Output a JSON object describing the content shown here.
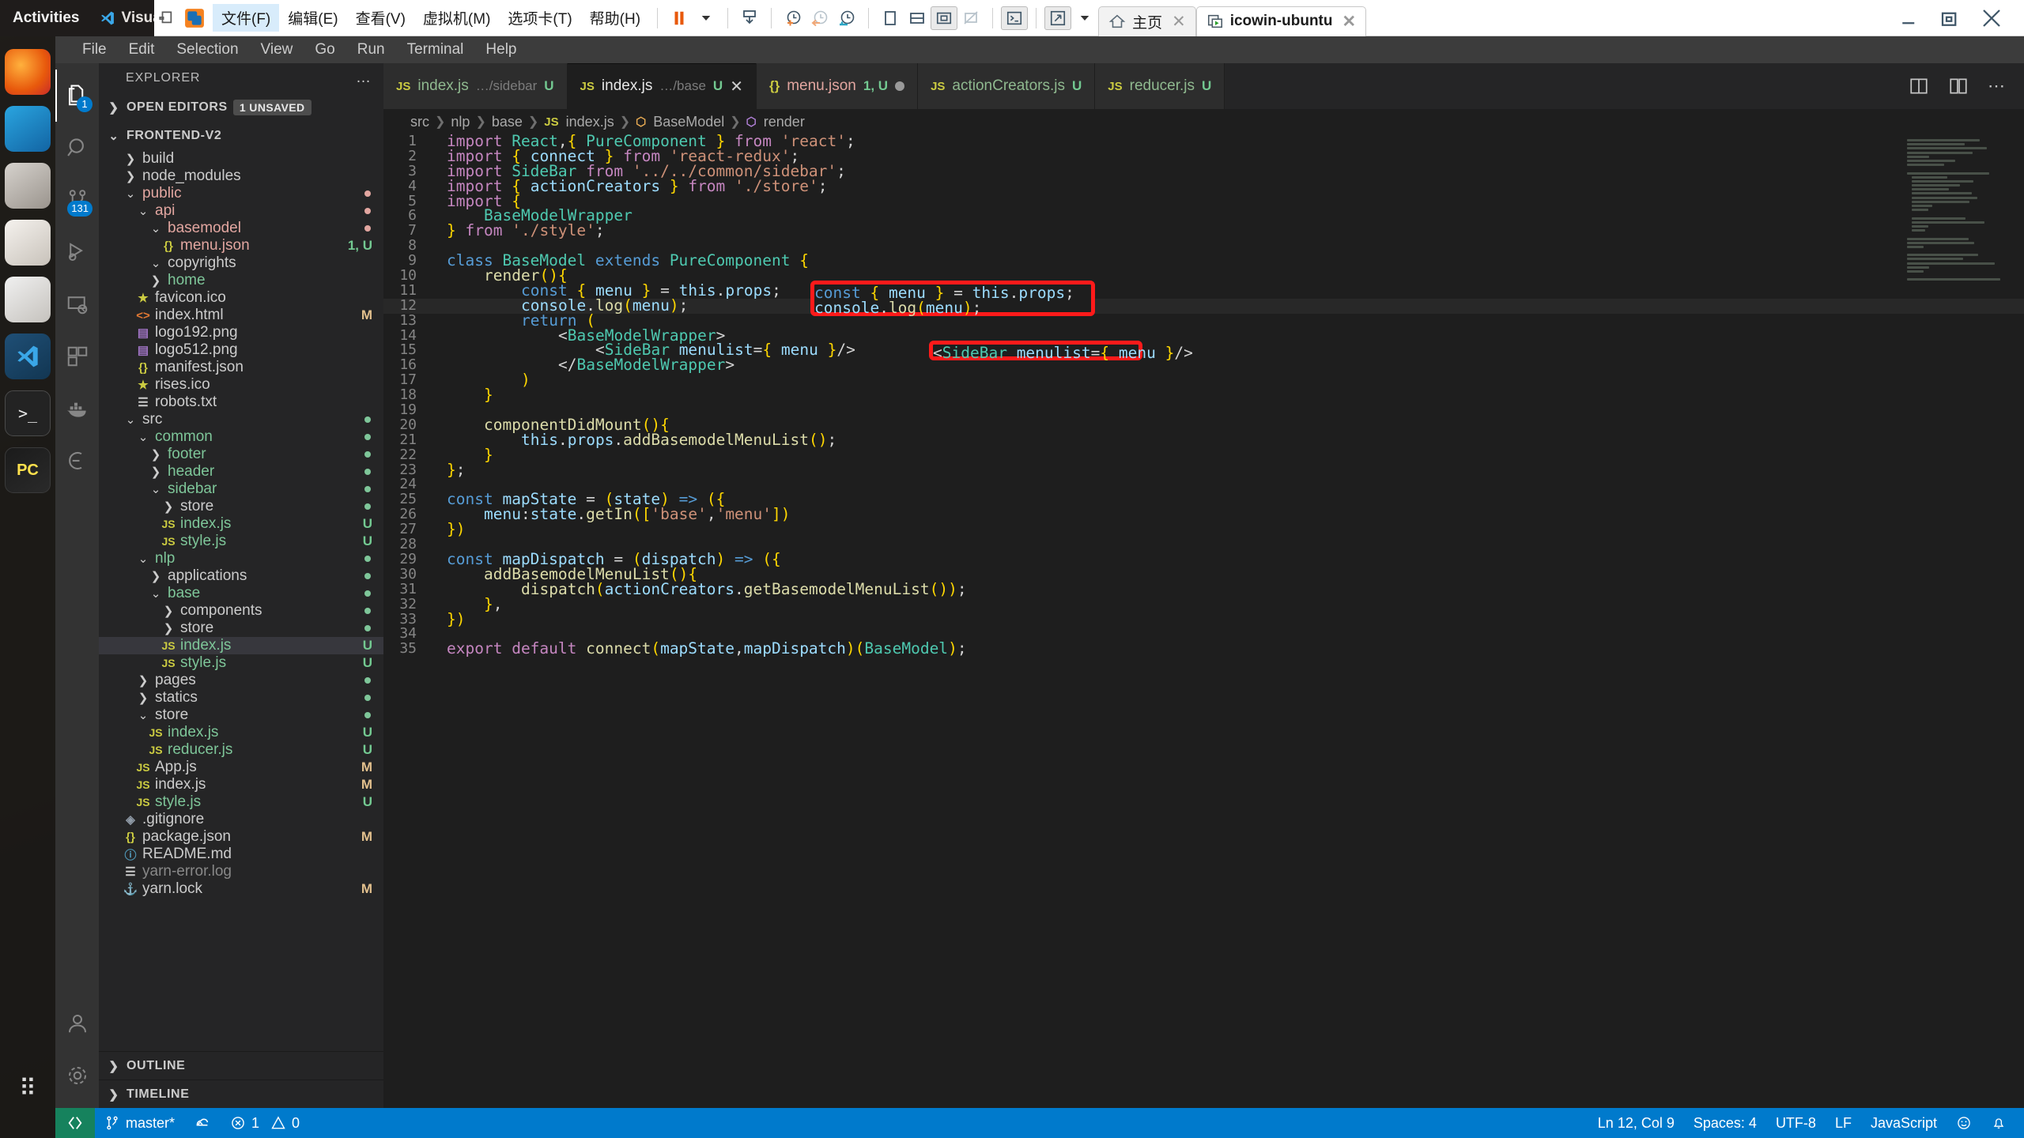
{
  "gnome": {
    "activities": "Activities",
    "app_name": "Visual Stu",
    "locale": "zh",
    "icons": [
      "network-icon",
      "volume-icon",
      "power-icon",
      "chevron-down-icon"
    ]
  },
  "vmware": {
    "menus": [
      {
        "label": "文件(F)",
        "active": true
      },
      {
        "label": "编辑(E)",
        "active": false
      },
      {
        "label": "查看(V)",
        "active": false
      },
      {
        "label": "虚拟机(M)",
        "active": false
      },
      {
        "label": "选项卡(T)",
        "active": false
      },
      {
        "label": "帮助(H)",
        "active": false
      }
    ],
    "toolbar_icons": [
      "pause-icon",
      "chevron-down-icon",
      "snapshot-manager-icon",
      "take-snapshot-icon",
      "revert-snapshot-icon",
      "manage-snapshots-icon",
      "single-pane-icon",
      "split-pane-icon",
      "fullscreen-icon",
      "unity-icon",
      "console-icon",
      "stretch-icon",
      "chevron-down-icon"
    ],
    "tabs": [
      {
        "label": "主页",
        "icon": "home-icon",
        "selected": false
      },
      {
        "label": "icowin-ubuntu",
        "icon": "vm-running-icon",
        "selected": true
      }
    ],
    "window_buttons": [
      "minimize-icon",
      "restore-icon",
      "close-icon"
    ]
  },
  "vscode": {
    "menubar": [
      "File",
      "Edit",
      "Selection",
      "View",
      "Go",
      "Run",
      "Terminal",
      "Help"
    ],
    "activitybar": [
      {
        "name": "explorer",
        "icon": "files-icon",
        "badge": "1",
        "active": true
      },
      {
        "name": "search",
        "icon": "search-icon",
        "badge": "",
        "active": false
      },
      {
        "name": "source-control",
        "icon": "source-control-icon",
        "badge": "131",
        "active": false
      },
      {
        "name": "run-debug",
        "icon": "run-debug-icon",
        "badge": "",
        "active": false
      },
      {
        "name": "remote-explorer",
        "icon": "remote-explorer-icon",
        "badge": "",
        "active": false
      },
      {
        "name": "extensions",
        "icon": "extensions-icon",
        "badge": "",
        "active": false
      },
      {
        "name": "docker",
        "icon": "docker-icon",
        "badge": "",
        "active": false
      },
      {
        "name": "eslint",
        "icon": "eslint-icon",
        "badge": "",
        "active": false
      }
    ],
    "activitybar_bottom": [
      {
        "name": "accounts",
        "icon": "account-icon"
      },
      {
        "name": "settings",
        "icon": "gear-icon"
      }
    ],
    "sidebar": {
      "title": "EXPLORER",
      "more_actions": "…",
      "open_editors": {
        "label": "OPEN EDITORS",
        "badge": "1 UNSAVED",
        "expanded": false
      },
      "project": {
        "label": "FRONTEND-V2",
        "expanded": true
      },
      "outline": {
        "label": "OUTLINE",
        "expanded": false
      },
      "timeline": {
        "label": "TIMELINE",
        "expanded": false
      },
      "tree": [
        {
          "label": "build",
          "indent": 1,
          "kind": "folder",
          "expanded": false,
          "status": "",
          "color": "#cccccc"
        },
        {
          "label": "node_modules",
          "indent": 1,
          "kind": "folder",
          "expanded": false,
          "status": "",
          "color": "#cccccc"
        },
        {
          "label": "public",
          "indent": 1,
          "kind": "folder",
          "expanded": true,
          "status": "",
          "color": "#e2a6a0",
          "dot": "#e2a6a0"
        },
        {
          "label": "api",
          "indent": 2,
          "kind": "folder",
          "expanded": true,
          "status": "",
          "color": "#e2a6a0",
          "dot": "#e2a6a0"
        },
        {
          "label": "basemodel",
          "indent": 3,
          "kind": "folder",
          "expanded": true,
          "status": "",
          "color": "#e2a6a0",
          "dot": "#e2a6a0"
        },
        {
          "label": "menu.json",
          "indent": 4,
          "kind": "json",
          "expanded": false,
          "status": "1, U",
          "color": "#e2a6a0"
        },
        {
          "label": "copyrights",
          "indent": 3,
          "kind": "folder",
          "expanded": true,
          "status": "",
          "color": "#cccccc"
        },
        {
          "label": "home",
          "indent": 3,
          "kind": "folder",
          "expanded": false,
          "status": "",
          "color": "#7ec699"
        },
        {
          "label": "favicon.ico",
          "indent": 2,
          "kind": "star",
          "expanded": false,
          "status": "",
          "color": "#cccccc"
        },
        {
          "label": "index.html",
          "indent": 2,
          "kind": "html",
          "expanded": false,
          "status": "M",
          "color": "#cccccc"
        },
        {
          "label": "logo192.png",
          "indent": 2,
          "kind": "image",
          "expanded": false,
          "status": "",
          "color": "#cccccc"
        },
        {
          "label": "logo512.png",
          "indent": 2,
          "kind": "image",
          "expanded": false,
          "status": "",
          "color": "#cccccc"
        },
        {
          "label": "manifest.json",
          "indent": 2,
          "kind": "json",
          "expanded": false,
          "status": "",
          "color": "#cccccc"
        },
        {
          "label": "rises.ico",
          "indent": 2,
          "kind": "star",
          "expanded": false,
          "status": "",
          "color": "#cccccc"
        },
        {
          "label": "robots.txt",
          "indent": 2,
          "kind": "text",
          "expanded": false,
          "status": "",
          "color": "#cccccc"
        },
        {
          "label": "src",
          "indent": 1,
          "kind": "folder",
          "expanded": true,
          "status": "",
          "color": "#cccccc",
          "dot": "#7ec699"
        },
        {
          "label": "common",
          "indent": 2,
          "kind": "folder",
          "expanded": true,
          "status": "",
          "color": "#7ec699",
          "dot": "#7ec699"
        },
        {
          "label": "footer",
          "indent": 3,
          "kind": "folder",
          "expanded": false,
          "status": "",
          "color": "#7ec699",
          "dot": "#7ec699"
        },
        {
          "label": "header",
          "indent": 3,
          "kind": "folder",
          "expanded": false,
          "status": "",
          "color": "#7ec699",
          "dot": "#7ec699"
        },
        {
          "label": "sidebar",
          "indent": 3,
          "kind": "folder",
          "expanded": true,
          "status": "",
          "color": "#7ec699",
          "dot": "#7ec699"
        },
        {
          "label": "store",
          "indent": 4,
          "kind": "folder",
          "expanded": false,
          "status": "",
          "color": "#cccccc",
          "dot": "#7ec699"
        },
        {
          "label": "index.js",
          "indent": 4,
          "kind": "js",
          "expanded": false,
          "status": "U",
          "color": "#7ec699"
        },
        {
          "label": "style.js",
          "indent": 4,
          "kind": "js",
          "expanded": false,
          "status": "U",
          "color": "#7ec699"
        },
        {
          "label": "nlp",
          "indent": 2,
          "kind": "folder",
          "expanded": true,
          "status": "",
          "color": "#7ec699",
          "dot": "#7ec699"
        },
        {
          "label": "applications",
          "indent": 3,
          "kind": "folder",
          "expanded": false,
          "status": "",
          "color": "#cccccc",
          "dot": "#7ec699"
        },
        {
          "label": "base",
          "indent": 3,
          "kind": "folder",
          "expanded": true,
          "status": "",
          "color": "#7ec699",
          "dot": "#7ec699"
        },
        {
          "label": "components",
          "indent": 4,
          "kind": "folder",
          "expanded": false,
          "status": "",
          "color": "#cccccc",
          "dot": "#7ec699"
        },
        {
          "label": "store",
          "indent": 4,
          "kind": "folder",
          "expanded": false,
          "status": "",
          "color": "#cccccc",
          "dot": "#7ec699"
        },
        {
          "label": "index.js",
          "indent": 4,
          "kind": "js",
          "expanded": false,
          "status": "U",
          "color": "#7ec699",
          "selected": true
        },
        {
          "label": "style.js",
          "indent": 4,
          "kind": "js",
          "expanded": false,
          "status": "U",
          "color": "#7ec699"
        },
        {
          "label": "pages",
          "indent": 2,
          "kind": "folder",
          "expanded": false,
          "status": "",
          "color": "#cccccc",
          "dot": "#7ec699"
        },
        {
          "label": "statics",
          "indent": 2,
          "kind": "folder",
          "expanded": false,
          "status": "",
          "color": "#cccccc",
          "dot": "#7ec699"
        },
        {
          "label": "store",
          "indent": 2,
          "kind": "folder",
          "expanded": true,
          "status": "",
          "color": "#cccccc",
          "dot": "#7ec699"
        },
        {
          "label": "index.js",
          "indent": 3,
          "kind": "js",
          "expanded": false,
          "status": "U",
          "color": "#7ec699"
        },
        {
          "label": "reducer.js",
          "indent": 3,
          "kind": "js",
          "expanded": false,
          "status": "U",
          "color": "#7ec699"
        },
        {
          "label": "App.js",
          "indent": 2,
          "kind": "js",
          "expanded": false,
          "status": "M",
          "color": "#cccccc"
        },
        {
          "label": "index.js",
          "indent": 2,
          "kind": "js",
          "expanded": false,
          "status": "M",
          "color": "#cccccc"
        },
        {
          "label": "style.js",
          "indent": 2,
          "kind": "js",
          "expanded": false,
          "status": "U",
          "color": "#7ec699"
        },
        {
          "label": ".gitignore",
          "indent": 1,
          "kind": "git",
          "expanded": false,
          "status": "",
          "color": "#cccccc"
        },
        {
          "label": "package.json",
          "indent": 1,
          "kind": "json",
          "expanded": false,
          "status": "M",
          "color": "#cccccc"
        },
        {
          "label": "README.md",
          "indent": 1,
          "kind": "md",
          "expanded": false,
          "status": "",
          "color": "#cccccc"
        },
        {
          "label": "yarn-error.log",
          "indent": 1,
          "kind": "text",
          "expanded": false,
          "status": "",
          "color": "#888888"
        },
        {
          "label": "yarn.lock",
          "indent": 1,
          "kind": "lock",
          "expanded": false,
          "status": "M",
          "color": "#cccccc"
        }
      ]
    },
    "tabs": [
      {
        "name": "index.js",
        "path": "…/sidebar",
        "badge": "U",
        "icon": "js-icon",
        "active": false,
        "closable": false,
        "dirty": false
      },
      {
        "name": "index.js",
        "path": "…/base",
        "badge": "U",
        "icon": "js-icon",
        "active": true,
        "closable": true,
        "dirty": false
      },
      {
        "name": "menu.json",
        "path": "",
        "badge": "1, U",
        "icon": "json-icon",
        "active": false,
        "closable": false,
        "dirty": true
      },
      {
        "name": "actionCreators.js",
        "path": "",
        "badge": "U",
        "icon": "js-icon",
        "active": false,
        "closable": false,
        "dirty": false
      },
      {
        "name": "reducer.js",
        "path": "",
        "badge": "U",
        "icon": "js-icon",
        "active": false,
        "closable": false,
        "dirty": false
      }
    ],
    "tabs_actions": [
      "split-editor-icon",
      "open-changes-icon",
      "more-actions-icon"
    ],
    "breadcrumb": [
      "src",
      "nlp",
      "base",
      "index.js",
      "BaseModel",
      "render"
    ],
    "code_lines": [
      {
        "n": 1,
        "text": "import React,{ PureComponent } from 'react';"
      },
      {
        "n": 2,
        "text": "import { connect } from 'react-redux';"
      },
      {
        "n": 3,
        "text": "import SideBar from '../../common/sidebar';"
      },
      {
        "n": 4,
        "text": "import { actionCreators } from './store';"
      },
      {
        "n": 5,
        "text": "import {"
      },
      {
        "n": 6,
        "text": "    BaseModelWrapper"
      },
      {
        "n": 7,
        "text": "} from './style';"
      },
      {
        "n": 8,
        "text": ""
      },
      {
        "n": 9,
        "text": "class BaseModel extends PureComponent {"
      },
      {
        "n": 10,
        "text": "    render(){"
      },
      {
        "n": 11,
        "text": "        const { menu } = this.props;"
      },
      {
        "n": 12,
        "text": "        console.log(menu);",
        "current": true
      },
      {
        "n": 13,
        "text": "        return ("
      },
      {
        "n": 14,
        "text": "            <BaseModelWrapper>"
      },
      {
        "n": 15,
        "text": "                <SideBar menulist={ menu }/>"
      },
      {
        "n": 16,
        "text": "            </BaseModelWrapper>"
      },
      {
        "n": 17,
        "text": "        )"
      },
      {
        "n": 18,
        "text": "    }"
      },
      {
        "n": 19,
        "text": ""
      },
      {
        "n": 20,
        "text": "    componentDidMount(){"
      },
      {
        "n": 21,
        "text": "        this.props.addBasemodelMenuList();"
      },
      {
        "n": 22,
        "text": "    }"
      },
      {
        "n": 23,
        "text": "};"
      },
      {
        "n": 24,
        "text": ""
      },
      {
        "n": 25,
        "text": "const mapState = (state) => ({"
      },
      {
        "n": 26,
        "text": "    menu:state.getIn(['base','menu'])"
      },
      {
        "n": 27,
        "text": "})"
      },
      {
        "n": 28,
        "text": ""
      },
      {
        "n": 29,
        "text": "const mapDispatch = (dispatch) => ({"
      },
      {
        "n": 30,
        "text": "    addBasemodelMenuList(){"
      },
      {
        "n": 31,
        "text": "        dispatch(actionCreators.getBasemodelMenuList());"
      },
      {
        "n": 32,
        "text": "    },"
      },
      {
        "n": 33,
        "text": "})"
      },
      {
        "n": 34,
        "text": ""
      },
      {
        "n": 35,
        "text": "export default connect(mapState,mapDispatch)(BaseModel);"
      }
    ],
    "annotations": [
      {
        "name": "annotation-box-props-log",
        "lines": "11-12",
        "color": "#ff1a1a",
        "text_line_1": "const { menu } = this.props;",
        "text_line_2": "console.log(menu);"
      },
      {
        "name": "annotation-box-sidebar-jsx",
        "lines": "15",
        "color": "#ff1a1a",
        "text_line_1": "<SideBar menulist={ menu }/>"
      }
    ],
    "statusbar": {
      "remote": "remote-indicator-icon",
      "branch": "master*",
      "sync": "sync-icon",
      "errors": "1",
      "warnings": "0",
      "position": "Ln 12, Col 9",
      "indent": "Spaces: 4",
      "encoding": "UTF-8",
      "eol": "LF",
      "language": "JavaScript",
      "feedback": "smiley-icon",
      "bell": "bell-icon"
    }
  }
}
